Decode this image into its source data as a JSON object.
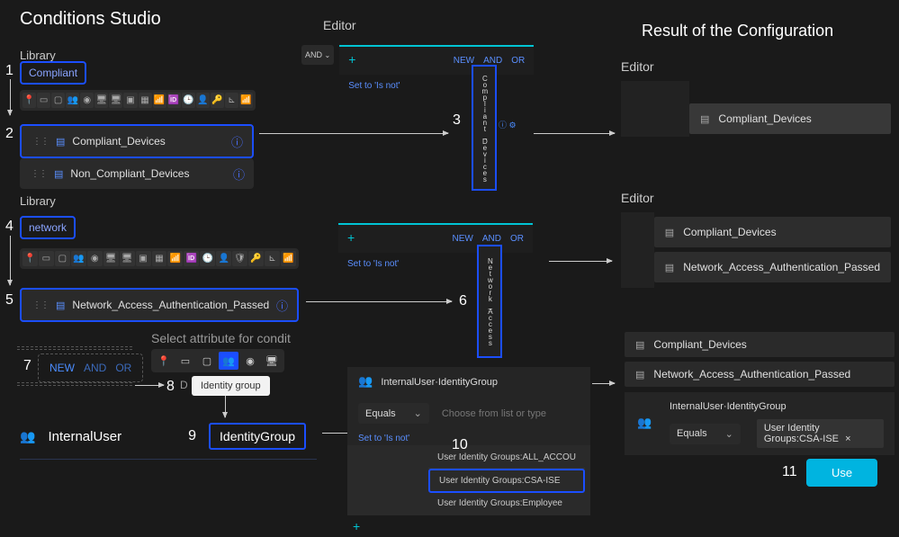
{
  "title": "Conditions Studio",
  "result_title": "Result of the Configuration",
  "library_label": "Library",
  "editor_label": "Editor",
  "steps": [
    "1",
    "2",
    "3",
    "4",
    "5",
    "6",
    "7",
    "8",
    "9",
    "10",
    "11"
  ],
  "search1": "Compliant",
  "lib1": {
    "item1": "Compliant_Devices",
    "item2": "Non_Compliant_Devices"
  },
  "search2": "network",
  "lib2": {
    "item1": "Network_Access_Authentication_Passed"
  },
  "and_op": "AND",
  "tags": {
    "new": "NEW",
    "and": "AND",
    "or": "OR"
  },
  "set_to": "Set to 'Is not'",
  "vert1": "Compliant_Devices",
  "vert2": "Network_Access",
  "attr_title": "Select attribute for condit",
  "tooltip": "Identity group",
  "tooltip_suffix": "D",
  "internal_user": "InternalUser",
  "identity_group": "IdentityGroup",
  "cond_label": "InternalUser·IdentityGroup",
  "equals": "Equals",
  "choose_ph": "Choose from list or type",
  "opts": {
    "o1": "User Identity Groups:ALL_ACCOU",
    "o2": "User Identity Groups:CSA-ISE",
    "o3": "User Identity Groups:Employee"
  },
  "result": {
    "r1": "Compliant_Devices",
    "r2": "Network_Access_Authentication_Passed",
    "r3_a": "Compliant_Devices",
    "r3_b": "Network_Access_Authentication_Passed",
    "r3_label": "InternalUser·IdentityGroup",
    "r3_val": "User Identity Groups:CSA-ISE",
    "close": "×"
  },
  "use_label": "Use",
  "plus": "+",
  "icons": {
    "pin": "📍",
    "card": "▭",
    "sq": "▢",
    "grp": "👥",
    "dot": "◉",
    "mon": "🖥",
    "mon2": "🖥",
    "win": "▣",
    "win2": "▦",
    "sig": "📶",
    "id": "🆔",
    "clk": "🕒",
    "usr": "👤",
    "key": "🔑",
    "net": "⊾",
    "wifi": "📶",
    "shield": "🛡"
  }
}
